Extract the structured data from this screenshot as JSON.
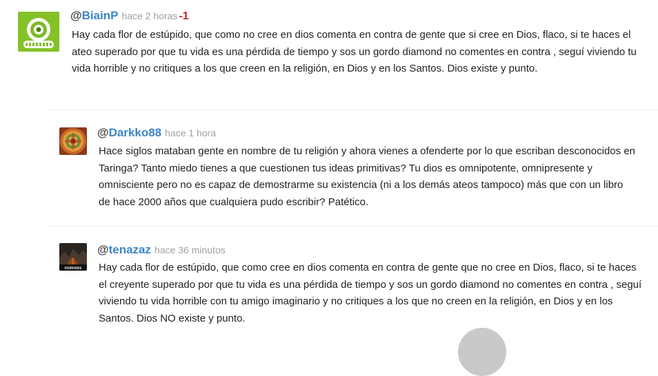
{
  "comments": [
    {
      "at": "@",
      "username": "BiainP",
      "time": "hace 2 horas",
      "votes": "-1",
      "avatar": "green-robot-avatar",
      "text": "Hay cada flor de estúpido, que como no cree en dios comenta en contra de gente que si cree en Dios, flaco, si te haces el ateo superado por que tu vida es una pérdida de tiempo y sos un gordo diamond no comentes en contra , seguí viviendo tu vida horrible y no critiques a los que creen en la religión, en Dios y en los Santos. Dios existe y punto."
    },
    {
      "at": "@",
      "username": "Darkko88",
      "time": "hace 1 hora",
      "avatar": "mandala-avatar",
      "text": "Hace siglos mataban gente en nombre de tu religión y ahora vienes a ofenderte por lo que escriban desconocidos en Taringa? Tanto miedo tienes a que cuestionen tus ideas primitivas? Tu dios es omnipotente, omnipresente y omnisciente pero no es capaz de demostrarme su existencia (ni a los demás ateos tampoco) más que con un libro de hace 2000 años que cualquiera pudo escribir? Patético."
    },
    {
      "at": "@",
      "username": "tenazaz",
      "time": "hace 36 minutos",
      "avatar": "dark-scene-avatar",
      "avatar_caption": "HUMANS",
      "text": "Hay cada flor de estúpido, que como cree en dios comenta en contra de gente que no cree en Dios, flaco, si te haces el creyente superado por que tu vida es una pérdida de tiempo y sos un gordo diamond no comentes en contra , seguí viviendo tu vida horrible con tu amigo imaginario y no critiques a los que no creen en la religión, en Dios y en los Santos. Dios NO existe y punto."
    }
  ],
  "colors": {
    "username": "#3d86c6",
    "time": "#a0a0a0",
    "negative_vote": "#d21f26",
    "divider": "#e8e8e8"
  }
}
